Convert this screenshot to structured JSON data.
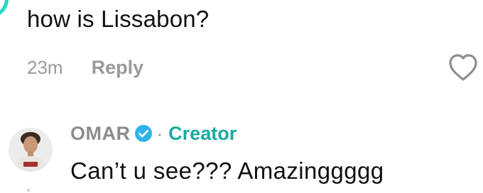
{
  "comment": {
    "text": "how is Lissabon?",
    "time": "23m",
    "reply_label": "Reply",
    "like_icon": "heart-outline-icon"
  },
  "reply": {
    "username": "OMAR",
    "badge_icon": "verified-badge-icon",
    "separator": "·",
    "creator_label": "Creator",
    "text": "Can’t u see??? Amazinggggg"
  },
  "colors": {
    "accent": "#28d6c3",
    "creator": "#1aaa9d",
    "muted": "#9a9a9a",
    "text": "#111111"
  }
}
